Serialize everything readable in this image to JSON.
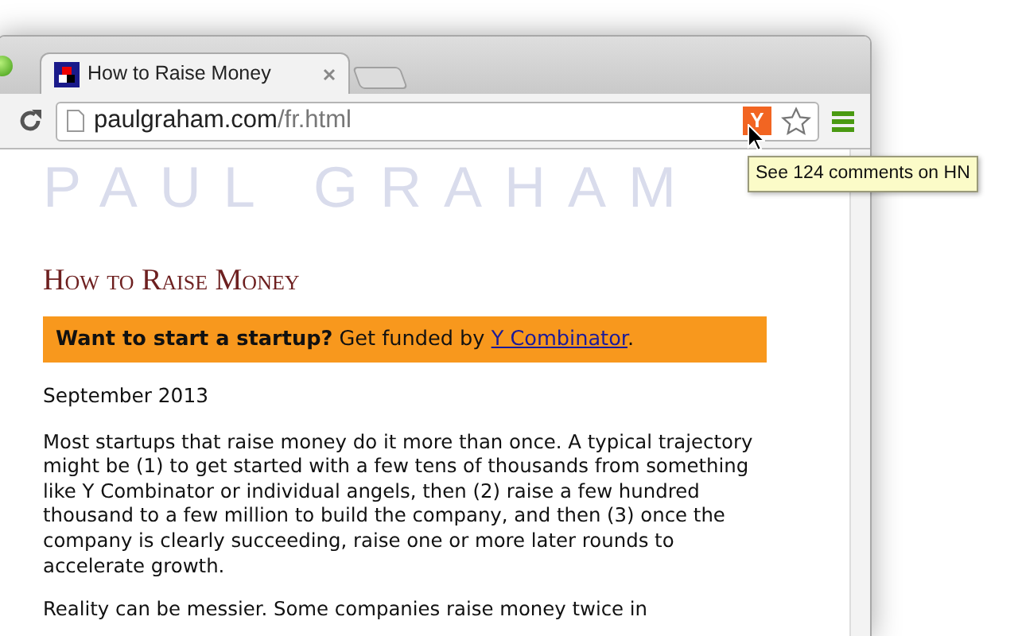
{
  "browser": {
    "tabs": [
      {
        "title": "How to Raise Money",
        "selected": true
      }
    ],
    "address": {
      "domain": "paulgraham.com",
      "path": "/fr.html"
    },
    "extension_badge": "Y",
    "tooltip": "See 124 comments on HN"
  },
  "page": {
    "logo": "PAUL GRAHAM",
    "title": "How to Raise Money",
    "banner": {
      "text": "**Want to start a startup?** Get funded by",
      "link": "Y Combinator",
      "end": "."
    },
    "date": "September 2013",
    "paragraphs": [
      "Most startups that raise money do it more than once. A typical trajectory might be (1) to get started with a few tens of thousands from something like Y Combinator or individual angels, then (2) raise a few hundred thousand to a few million to build the company, and then (3) once the company is clearly succeeding, raise one or more later rounds to accelerate growth.",
      "Reality can be messier. Some companies raise money twice in"
    ]
  }
}
